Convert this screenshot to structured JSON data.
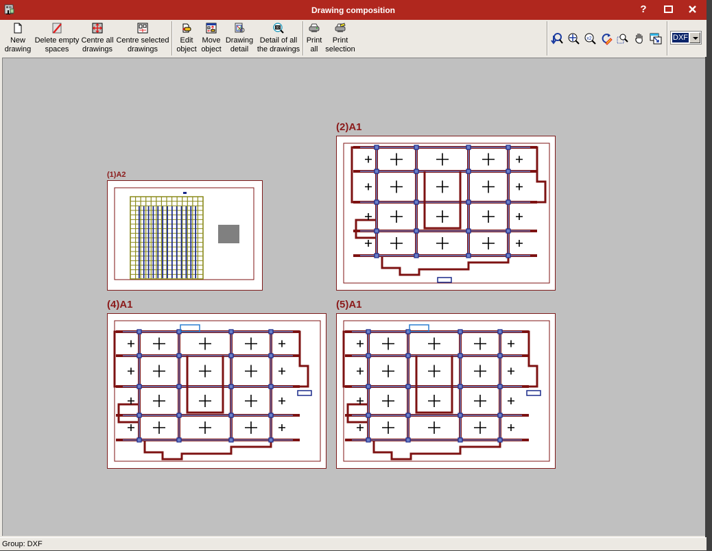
{
  "window": {
    "title": "Drawing composition",
    "help_label": "?",
    "maximize_label": "□",
    "close_label": "✕"
  },
  "toolbar": {
    "groups": [
      [
        {
          "id": "new-drawing",
          "line1": "New",
          "line2": "drawing",
          "icon": "page-icon"
        },
        {
          "id": "delete-empty-spaces",
          "line1": "Delete empty",
          "line2": "spaces",
          "icon": "delete-slash-icon"
        },
        {
          "id": "centre-all-drawings",
          "line1": "Centre all",
          "line2": "drawings",
          "icon": "centre-all-icon"
        },
        {
          "id": "centre-selected-drawings",
          "line1": "Centre selected",
          "line2": "drawings",
          "icon": "centre-selected-icon"
        }
      ],
      [
        {
          "id": "edit-object",
          "line1": "Edit",
          "line2": "object",
          "icon": "edit-pencil-icon"
        },
        {
          "id": "move-object",
          "line1": "Move",
          "line2": "object",
          "icon": "move-icon"
        },
        {
          "id": "drawing-detail",
          "line1": "Drawing",
          "line2": "detail",
          "icon": "drawing-detail-icon"
        },
        {
          "id": "detail-all-drawings",
          "line1": "Detail of all",
          "line2": "the drawings",
          "icon": "detail-all-icon"
        }
      ],
      [
        {
          "id": "print-all",
          "line1": "Print",
          "line2": "all",
          "icon": "printer-icon"
        },
        {
          "id": "print-selection",
          "line1": "Print",
          "line2": "selection",
          "icon": "printer-selection-icon"
        }
      ]
    ],
    "view_tools": [
      "redraw-icon",
      "zoom-all-icon",
      "zoom-x2-icon",
      "regenerate-icon",
      "zoom-window-icon",
      "pan-hand-icon",
      "window-swap-icon"
    ],
    "group_select": {
      "value": "DXF"
    }
  },
  "sheets": [
    {
      "label": "(1)A2",
      "type": "grid"
    },
    {
      "label": "(2)A1",
      "type": "plan-a"
    },
    {
      "label": "(4)A1",
      "type": "plan-b"
    },
    {
      "label": "(5)A1",
      "type": "plan-b"
    }
  ],
  "status": {
    "text": "Group: DXF"
  },
  "colors": {
    "title_bar": "#b0271e",
    "sheet_label": "#8b1a1a",
    "wall": "#7d1212",
    "beam": "#6a7fc8",
    "column": "#1a2a8a",
    "grid_olive": "#8a8a1a",
    "canvas": "#c0c0c0"
  }
}
